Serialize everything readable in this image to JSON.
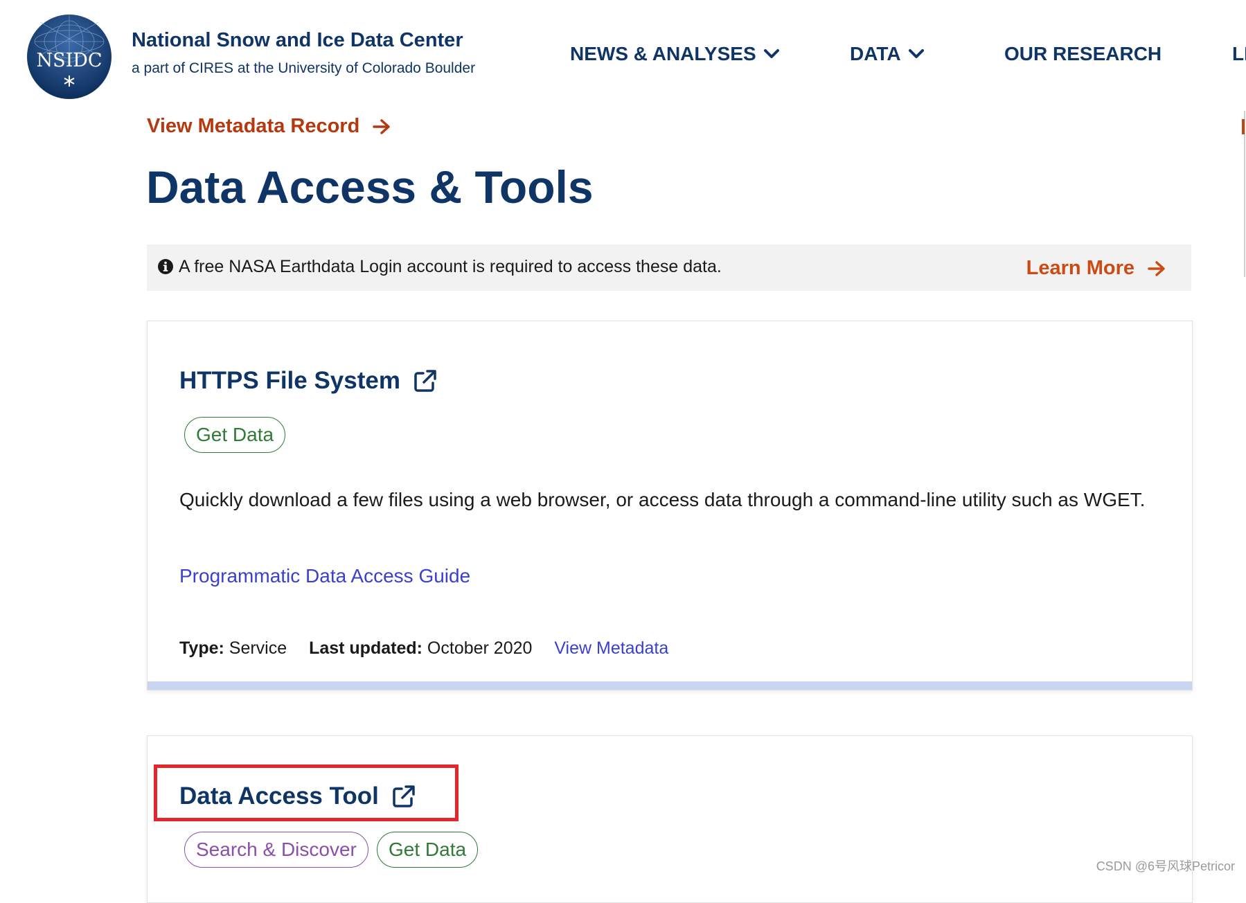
{
  "header": {
    "logo_text": "NSIDC",
    "org_name": "National Snow and Ice Data Center",
    "org_sub": "a part of CIRES at the University of Colorado Boulder"
  },
  "nav": {
    "news": "NEWS & ANALYSES",
    "data": "DATA",
    "research": "OUR RESEARCH",
    "partial": "LE"
  },
  "metadata_link": "View Metadata Record",
  "page_title": "Data Access & Tools",
  "alert": {
    "text": "A free NASA Earthdata Login account is required to access these data.",
    "learn_more": "Learn More"
  },
  "cards": [
    {
      "title": "HTTPS File System",
      "get_data": "Get Data",
      "description": "Quickly download a few files using a web browser, or access data through a command-line utility such as WGET.",
      "guide_link": "Programmatic Data Access Guide",
      "type_label": "Type:",
      "type_value": "Service",
      "updated_label": "Last updated:",
      "updated_value": "October 2020",
      "view_metadata": "View Metadata"
    },
    {
      "title": "Data Access Tool",
      "search_discover": "Search & Discover",
      "get_data": "Get Data"
    }
  ],
  "watermark": "CSDN @6号风球Petricor",
  "colors": {
    "navy": "#0f3466",
    "accent_orange": "#b5380f",
    "link_blue": "#3a3fd0",
    "pill_green": "#2f7a37",
    "pill_purple": "#8a4fa8",
    "highlight_red": "#e3282c"
  }
}
